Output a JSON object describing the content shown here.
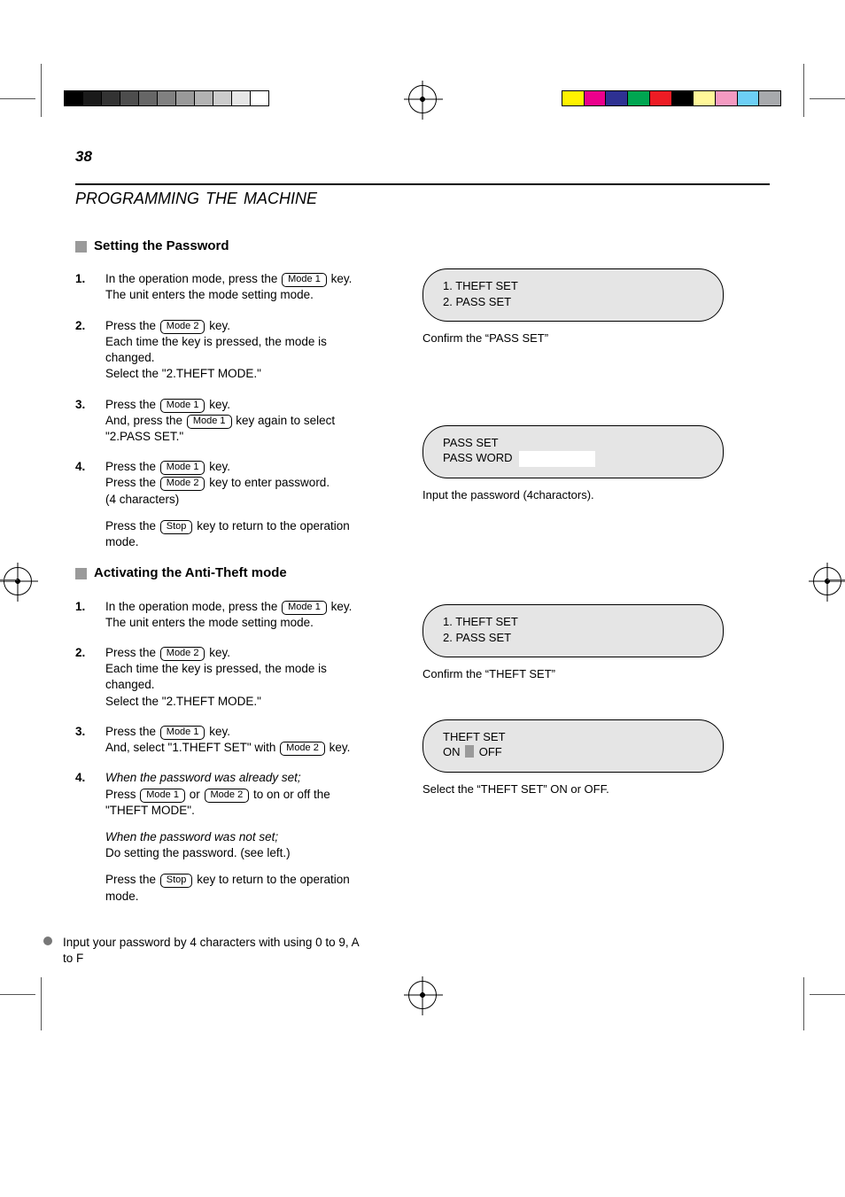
{
  "page_number": "38",
  "section_title": "PROGRAMMING    THE    MACHINE",
  "keys": {
    "mode1": "Mode 1",
    "mode2": "Mode 2",
    "stop": "Stop"
  },
  "sectionA": {
    "title": "Setting the Password",
    "step1_a": "In the operation mode, press the ",
    "step1_b": " key.",
    "step1_c": "The unit enters the mode setting mode.",
    "step2_a": "Press the ",
    "step2_b": " key.",
    "step2_c": "Each time the key is pressed, the mode is changed.",
    "step2_d": "Select the \"2.THEFT MODE.\"",
    "step3_a": "Press the ",
    "step3_b": " key.",
    "step3_c": "And, press the ",
    "step3_d": " key again to select \"2.PASS SET.\"",
    "step4_a": "Press the ",
    "step4_b": " key.",
    "step4_c": "Press the ",
    "step4_d": " key to enter password.",
    "step4_e": "(4 characters)",
    "exit_a": "Press the ",
    "exit_b": " key to return to the operation mode."
  },
  "sectionB": {
    "title": "Activating the Anti-Theft mode",
    "step1_a": "In the operation mode, press the ",
    "step1_b": " key.",
    "step1_c": "The unit enters the mode setting mode.",
    "step2_a": "Press the ",
    "step2_b": " key.",
    "step2_c": "Each time the key is pressed, the mode is changed.",
    "step2_d": "Select the \"2.THEFT MODE.\"",
    "step3_a": "Press the ",
    "step3_b": " key.",
    "step3_c": "And, select \"1.THEFT SET\" with ",
    "step3_d": " key.",
    "step4_title": "When the password was already set;",
    "step4_a": "Press ",
    "step4_b": " or ",
    "step4_c": " to on or off the \"THEFT MODE\".",
    "step4_d": "When the password was not set;",
    "step4_e": "Do setting the password. (see left.)",
    "exit_a": "Press the ",
    "exit_b": " key to return to the operation mode."
  },
  "note": "Input your password by 4 characters with using 0 to 9, A to F",
  "lcd": {
    "row1_l1": "1. THEFT SET",
    "row1_l2": "2. PASS SET",
    "row1_caption": "Confirm the “PASS SET”",
    "row2_l1": "PASS SET",
    "row2_l2_label": "PASS WORD",
    "row2_caption": "Input the password (4charactors).",
    "row3_l1": "1. THEFT SET",
    "row3_l2": "2. PASS SET",
    "row3_caption": "Confirm the “THEFT SET”",
    "row4_l1": "THEFT SET",
    "row4_l2_a": "ON",
    "row4_l2_b": "OFF",
    "row4_caption": "Select the “THEFT SET” ON or OFF."
  }
}
